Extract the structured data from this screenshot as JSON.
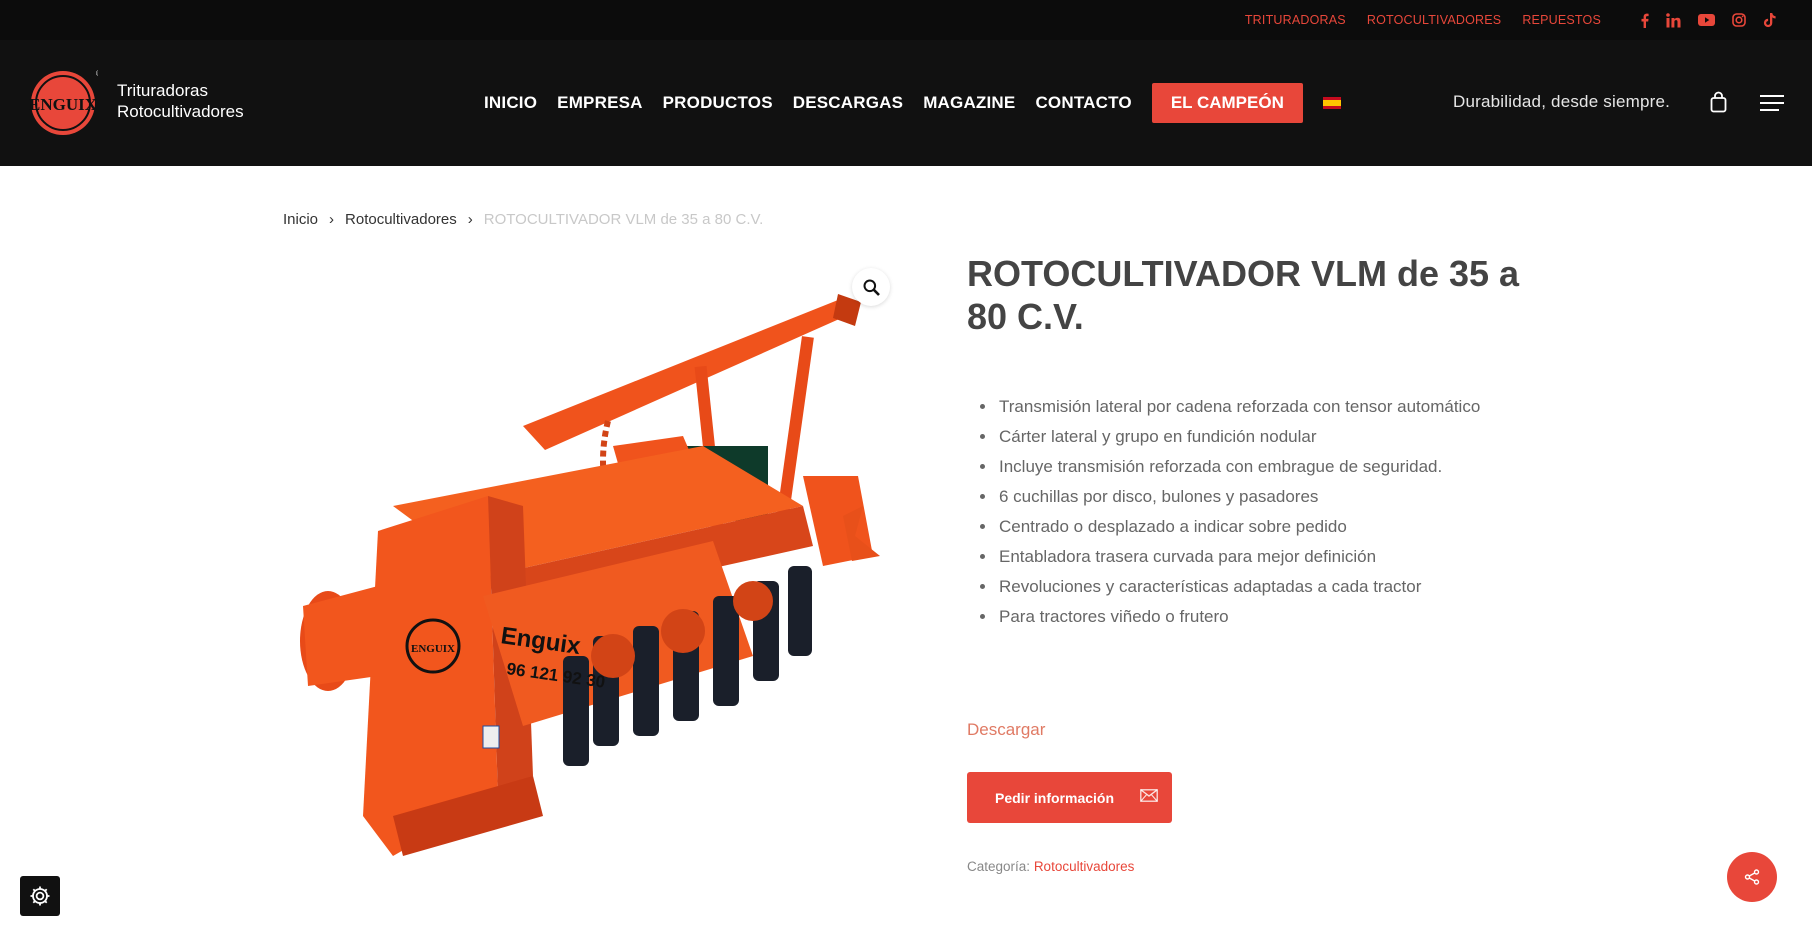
{
  "topbar": {
    "links": [
      "TRITURADORAS",
      "ROTOCULTIVADORES",
      "REPUESTOS"
    ],
    "social": [
      "facebook-icon",
      "linkedin-icon",
      "youtube-icon",
      "instagram-icon",
      "tiktok-icon"
    ]
  },
  "header": {
    "brand_line1": "Trituradoras",
    "brand_line2": "Rotocultivadores",
    "logo_text": "ENGUIX",
    "nav": [
      "INICIO",
      "EMPRESA",
      "PRODUCTOS",
      "DESCARGAS",
      "MAGAZINE",
      "CONTACTO"
    ],
    "cta": "EL CAMPEÓN",
    "tagline": "Durabilidad, desde siempre."
  },
  "breadcrumb": {
    "home": "Inicio",
    "category": "Rotocultivadores",
    "current": "ROTOCULTIVADOR VLM de 35 a 80 C.V."
  },
  "product": {
    "title": "ROTOCULTIVADOR VLM de 35 a 80 C.V.",
    "features": [
      "Transmisión lateral por cadena reforzada con tensor automático",
      "Cárter lateral y grupo en fundición nodular",
      "Incluye transmisión reforzada con embrague de seguridad.",
      "6 cuchillas por disco, bulones y pasadores",
      "Centrado o desplazado a indicar sobre pedido",
      "Entabladora trasera curvada para mejor definición",
      "Revoluciones y características adaptadas a cada tractor",
      "Para tractores viñedo o frutero"
    ],
    "download_label": "Descargar",
    "info_button": "Pedir información",
    "category_label": "Categoría:",
    "category_value": "Rotocultivadores",
    "machine_brand": "Enguix",
    "machine_phone": "96 121 92 30",
    "machine_tag": "ENGUIX"
  },
  "colors": {
    "accent": "#e8473a",
    "header_bg": "#111111",
    "topbar_bg": "#0c0c0c",
    "machine": "#f2541c"
  }
}
